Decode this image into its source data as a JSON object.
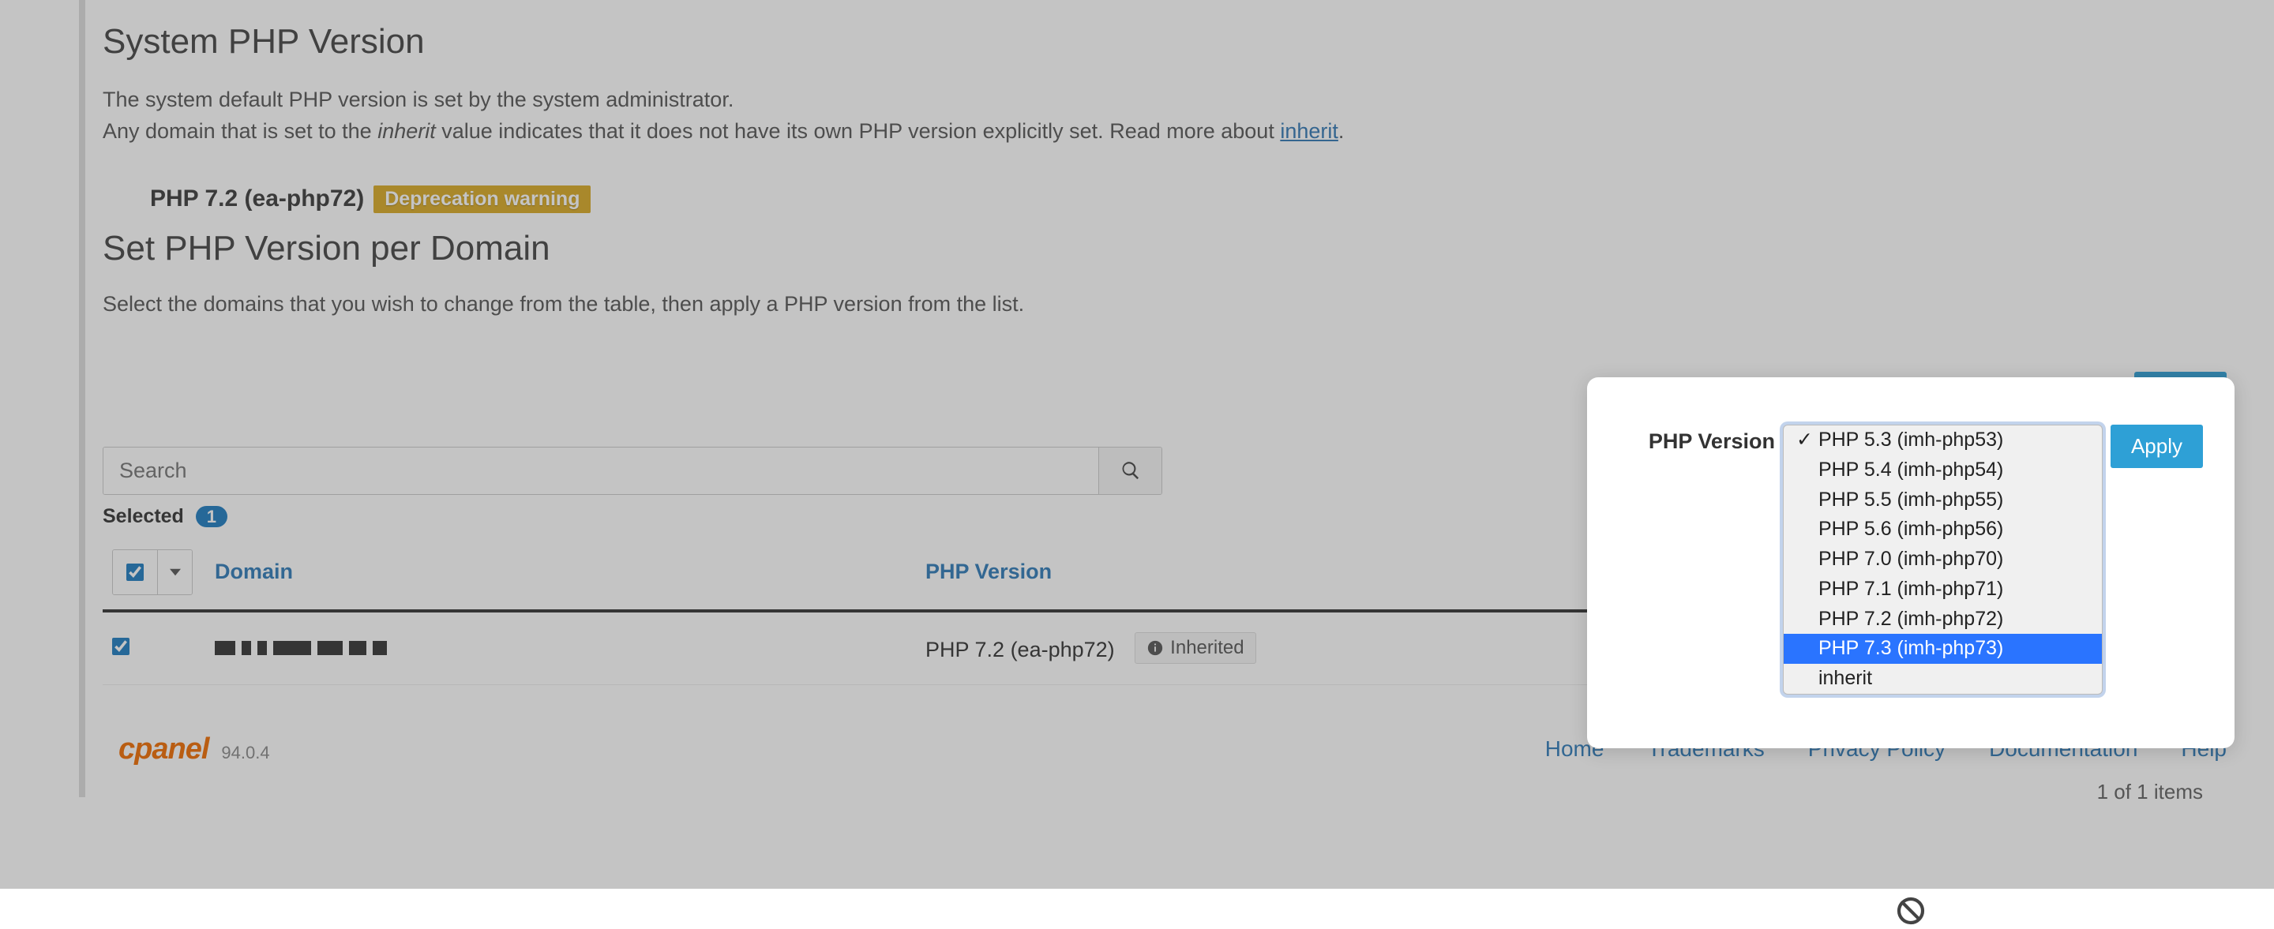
{
  "system_php": {
    "heading": "System PHP Version",
    "desc_line1": "The system default PHP version is set by the system administrator.",
    "desc_line2_pre": "Any domain that is set to the ",
    "desc_line2_em": "inherit",
    "desc_line2_mid": " value indicates that it does not have its own PHP version explicitly set. Read more about ",
    "desc_line2_link": "inherit",
    "desc_line2_post": ".",
    "php_version": "PHP 7.2 (ea-php72)",
    "deprecation_badge": "Deprecation warning"
  },
  "per_domain": {
    "heading": "Set PHP Version per Domain",
    "instructions": "Select the domains that you wish to change from the table, then apply a PHP version from the list."
  },
  "picker": {
    "label": "PHP Version",
    "apply": "Apply",
    "options": [
      "PHP 5.3 (imh-php53)",
      "PHP 5.4 (imh-php54)",
      "PHP 5.5 (imh-php55)",
      "PHP 5.6 (imh-php56)",
      "PHP 7.0 (imh-php70)",
      "PHP 7.1 (imh-php71)",
      "PHP 7.2 (imh-php72)",
      "PHP 7.3 (imh-php73)",
      "inherit"
    ],
    "selected_index": 0,
    "highlighted_index": 7
  },
  "search": {
    "placeholder": "Search"
  },
  "table": {
    "selected_label": "Selected",
    "selected_count": "1",
    "items_count": "1 of 1 items",
    "col_domain": "Domain",
    "col_php": "PHP Version",
    "row_php": "PHP 7.2 (ea-php72)",
    "inherited_label": "Inherited"
  },
  "footer": {
    "logo": "cPanel",
    "version": "94.0.4",
    "links": {
      "home": "Home",
      "trademarks": "Trademarks",
      "privacy": "Privacy Policy",
      "docs": "Documentation",
      "help": "Help"
    }
  }
}
